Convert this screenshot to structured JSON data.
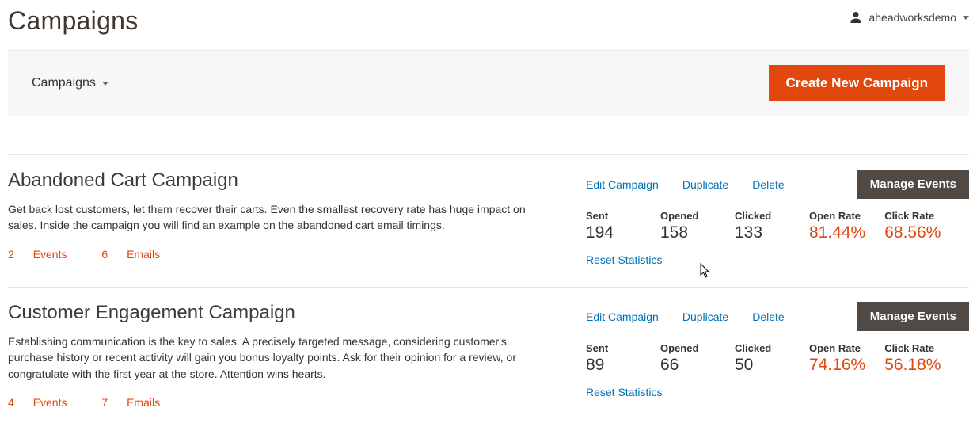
{
  "header": {
    "title": "Campaigns",
    "user": "aheadworksdemo"
  },
  "toolbar": {
    "dropdown_label": "Campaigns",
    "create_label": "Create New Campaign"
  },
  "actions": {
    "edit": "Edit Campaign",
    "duplicate": "Duplicate",
    "delete": "Delete",
    "manage": "Manage Events",
    "reset": "Reset Statistics"
  },
  "stat_labels": {
    "sent": "Sent",
    "opened": "Opened",
    "clicked": "Clicked",
    "open_rate": "Open Rate",
    "click_rate": "Click Rate"
  },
  "counts_labels": {
    "events_word": "Events",
    "emails_word": "Emails"
  },
  "campaigns": [
    {
      "title": "Abandoned Cart Campaign",
      "description": "Get back lost customers, let them recover their carts. Even the smallest recovery rate has huge impact on sales. Inside the campaign you will find an example on the abandoned cart email timings.",
      "events": "2",
      "emails": "6",
      "stats": {
        "sent": "194",
        "opened": "158",
        "clicked": "133",
        "open_rate": "81.44%",
        "click_rate": "68.56%"
      }
    },
    {
      "title": "Customer Engagement Campaign",
      "description": "Establishing communication is the key to sales. A precisely targeted message, considering customer's purchase history or recent activity will gain you bonus loyalty points. Ask for their opinion for a review, or congratulate with the first year at the store. Attention wins hearts.",
      "events": "4",
      "emails": "7",
      "stats": {
        "sent": "89",
        "opened": "66",
        "clicked": "50",
        "open_rate": "74.16%",
        "click_rate": "56.18%"
      }
    }
  ]
}
